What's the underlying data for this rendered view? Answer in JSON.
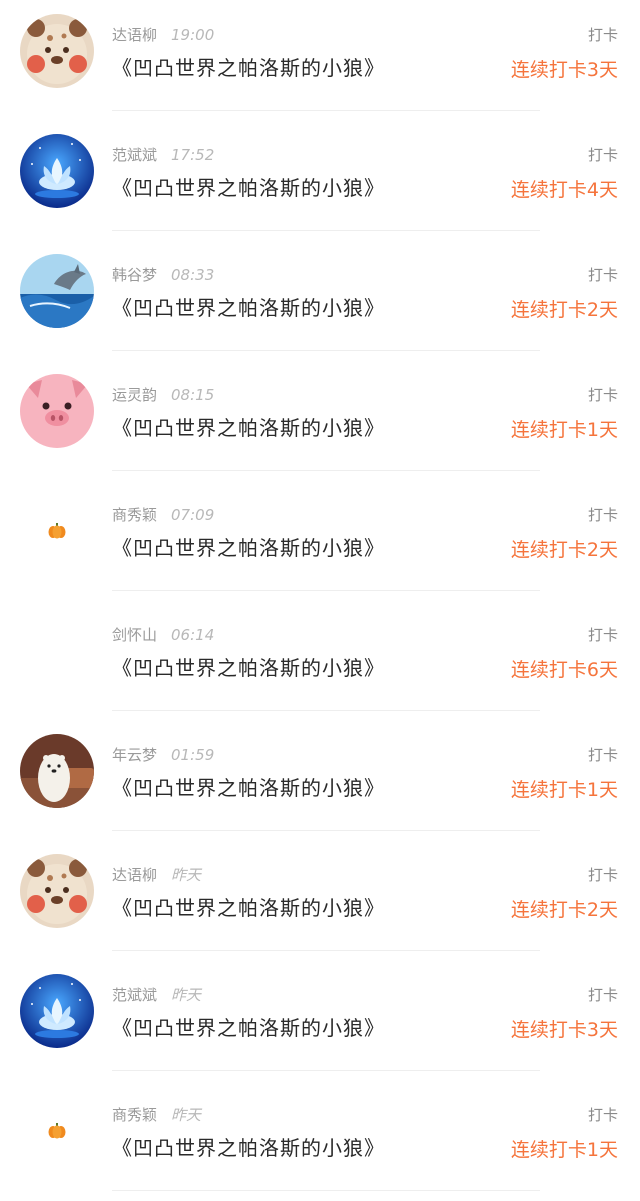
{
  "colors": {
    "streak": "#f5743c",
    "name": "#9a9a9a",
    "title": "#2a2a2a"
  },
  "rows": [
    {
      "name": "达语柳",
      "time": "19:00",
      "title": "《凹凸世界之帕洛斯的小狼》",
      "action": "打卡",
      "streak": "连续打卡3天",
      "avatar_icon": "bear-avatar-icon"
    },
    {
      "name": "范斌斌",
      "time": "17:52",
      "title": "《凹凸世界之帕洛斯的小狼》",
      "action": "打卡",
      "streak": "连续打卡4天",
      "avatar_icon": "lotus-avatar-icon"
    },
    {
      "name": "韩谷梦",
      "time": "08:33",
      "title": "《凹凸世界之帕洛斯的小狼》",
      "action": "打卡",
      "streak": "连续打卡2天",
      "avatar_icon": "dolphin-avatar-icon"
    },
    {
      "name": "运灵韵",
      "time": "08:15",
      "title": "《凹凸世界之帕洛斯的小狼》",
      "action": "打卡",
      "streak": "连续打卡1天",
      "avatar_icon": "pig-avatar-icon"
    },
    {
      "name": "商秀颖",
      "time": "07:09",
      "title": "《凹凸世界之帕洛斯的小狼》",
      "action": "打卡",
      "streak": "连续打卡2天",
      "avatar_icon": "pumpkin-icon"
    },
    {
      "name": "剑怀山",
      "time": "06:14",
      "title": "《凹凸世界之帕洛斯的小狼》",
      "action": "打卡",
      "streak": "连续打卡6天",
      "avatar_icon": "empty-avatar"
    },
    {
      "name": "年云梦",
      "time": "01:59",
      "title": "《凹凸世界之帕洛斯的小狼》",
      "action": "打卡",
      "streak": "连续打卡1天",
      "avatar_icon": "polar-bear-avatar-icon"
    },
    {
      "name": "达语柳",
      "time": "昨天",
      "title": "《凹凸世界之帕洛斯的小狼》",
      "action": "打卡",
      "streak": "连续打卡2天",
      "avatar_icon": "bear-avatar-icon"
    },
    {
      "name": "范斌斌",
      "time": "昨天",
      "title": "《凹凸世界之帕洛斯的小狼》",
      "action": "打卡",
      "streak": "连续打卡3天",
      "avatar_icon": "lotus-avatar-icon"
    },
    {
      "name": "商秀颖",
      "time": "昨天",
      "title": "《凹凸世界之帕洛斯的小狼》",
      "action": "打卡",
      "streak": "连续打卡1天",
      "avatar_icon": "pumpkin-icon"
    }
  ]
}
